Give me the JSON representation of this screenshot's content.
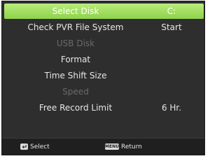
{
  "menu": {
    "items": [
      {
        "label": "Select Disk",
        "value": "C:",
        "selected": true,
        "enabled": true
      },
      {
        "label": "Check PVR File System",
        "value": "Start",
        "selected": false,
        "enabled": true
      },
      {
        "label": "USB Disk",
        "value": "",
        "selected": false,
        "enabled": false
      },
      {
        "label": "Format",
        "value": "",
        "selected": false,
        "enabled": true
      },
      {
        "label": "Time Shift Size",
        "value": "",
        "selected": false,
        "enabled": true
      },
      {
        "label": "Speed",
        "value": "",
        "selected": false,
        "enabled": false
      },
      {
        "label": "Free Record Limit",
        "value": "6 Hr.",
        "selected": false,
        "enabled": true
      }
    ]
  },
  "footer": {
    "select_key_icon": "ok-key-icon",
    "select_label": "Select",
    "return_key_icon": "menu-key-icon",
    "return_key_text": "MENU",
    "return_label": "Return"
  },
  "colors": {
    "highlight": "#9edb5a",
    "background": "#2e2e2e",
    "text": "#e6e6e6",
    "disabled_text": "#6a6a6a"
  }
}
